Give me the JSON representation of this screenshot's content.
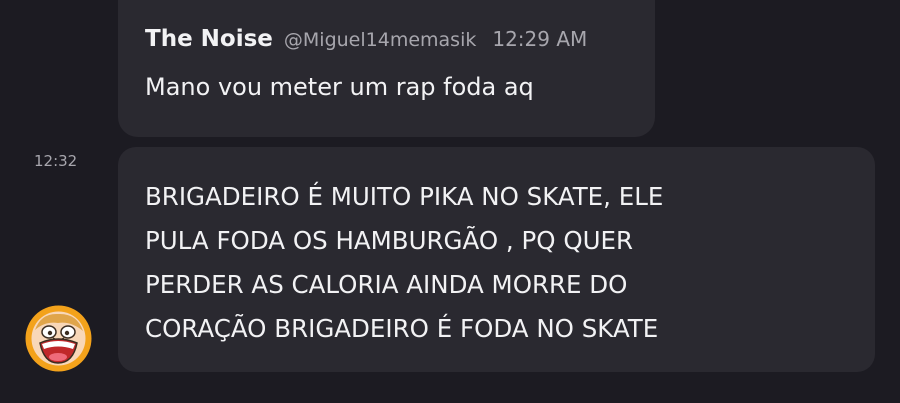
{
  "messages": [
    {
      "author": "The Noise",
      "handle": "@Miguel14memasik",
      "time": "12:29 AM",
      "text": "Mano vou meter um rap foda aq"
    },
    {
      "side_time": "12:32",
      "lines": [
        "BRIGADEIRO É MUITO PIKA NO SKATE, ELE",
        "PULA FODA OS HAMBURGÃO , PQ QUER",
        "PERDER AS CALORIA AINDA MORRE DO",
        "CORAÇÃO BRIGADEIRO É FODA NO SKATE"
      ]
    }
  ],
  "colors": {
    "background": "#1c1b22",
    "bubble": "#2a2930",
    "text": "#f2f2f4",
    "muted": "#a7a6ad",
    "avatar_ring": "#f3a21b"
  },
  "avatar": {
    "icon": "cartoon-face-avatar"
  }
}
